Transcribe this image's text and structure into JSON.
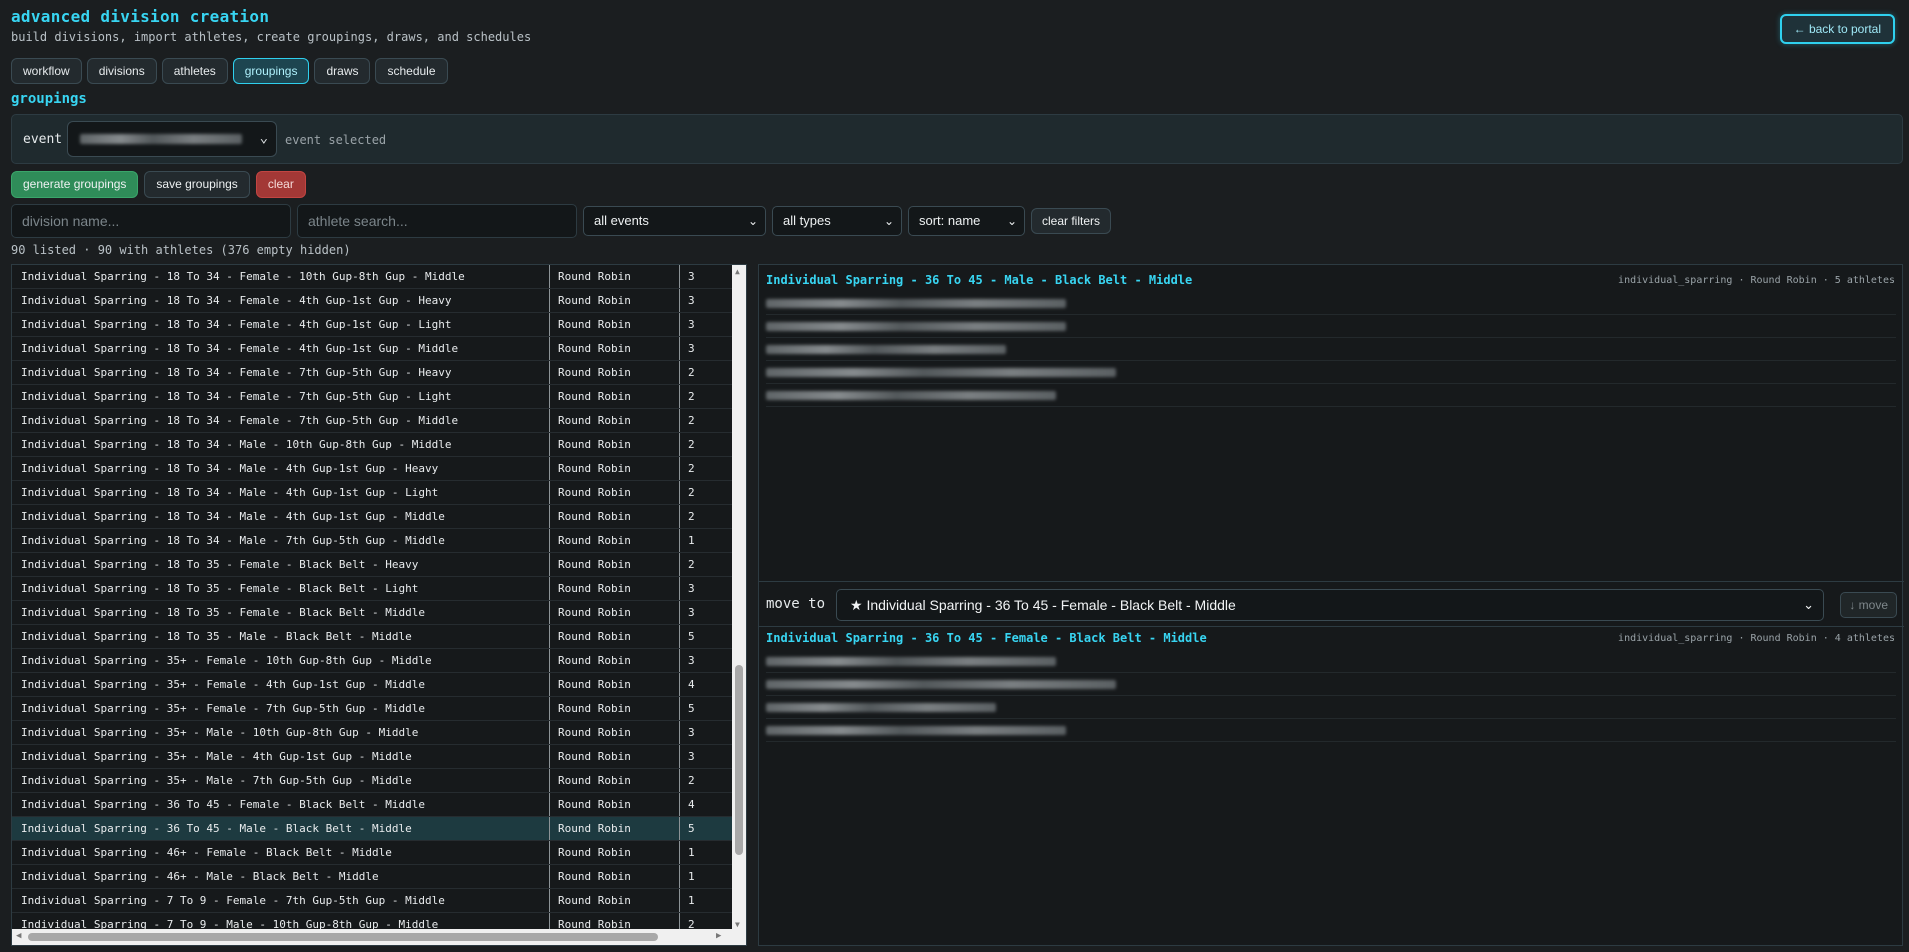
{
  "header": {
    "title": "advanced division creation",
    "subtitle": "build divisions, import athletes, create groupings, draws, and schedules",
    "back_label": "← back to portal"
  },
  "tabs": [
    {
      "label": "workflow",
      "active": false
    },
    {
      "label": "divisions",
      "active": false
    },
    {
      "label": "athletes",
      "active": false
    },
    {
      "label": "groupings",
      "active": true
    },
    {
      "label": "draws",
      "active": false
    },
    {
      "label": "schedule",
      "active": false
    }
  ],
  "section_title": "groupings",
  "event_bar": {
    "label": "event",
    "status": "event selected",
    "chevron_icon": "chevron-down-icon"
  },
  "actions": {
    "generate": "generate groupings",
    "save": "save groupings",
    "clear": "clear"
  },
  "filters": {
    "division_placeholder": "division name...",
    "athlete_placeholder": "athlete search...",
    "event_filter": "all events",
    "type_filter": "all types",
    "sort": "sort: name",
    "clear_label": "clear filters"
  },
  "summary": "90 listed · 90 with athletes (376 empty hidden)",
  "divisions": [
    {
      "name": "Individual Sparring - 18 To 34 - Female - 10th Gup-8th Gup - Middle",
      "type": "Round Robin",
      "count": "3"
    },
    {
      "name": "Individual Sparring - 18 To 34 - Female - 4th Gup-1st Gup - Heavy",
      "type": "Round Robin",
      "count": "3"
    },
    {
      "name": "Individual Sparring - 18 To 34 - Female - 4th Gup-1st Gup - Light",
      "type": "Round Robin",
      "count": "3"
    },
    {
      "name": "Individual Sparring - 18 To 34 - Female - 4th Gup-1st Gup - Middle",
      "type": "Round Robin",
      "count": "3"
    },
    {
      "name": "Individual Sparring - 18 To 34 - Female - 7th Gup-5th Gup - Heavy",
      "type": "Round Robin",
      "count": "2"
    },
    {
      "name": "Individual Sparring - 18 To 34 - Female - 7th Gup-5th Gup - Light",
      "type": "Round Robin",
      "count": "2"
    },
    {
      "name": "Individual Sparring - 18 To 34 - Female - 7th Gup-5th Gup - Middle",
      "type": "Round Robin",
      "count": "2"
    },
    {
      "name": "Individual Sparring - 18 To 34 - Male - 10th Gup-8th Gup - Middle",
      "type": "Round Robin",
      "count": "2"
    },
    {
      "name": "Individual Sparring - 18 To 34 - Male - 4th Gup-1st Gup - Heavy",
      "type": "Round Robin",
      "count": "2"
    },
    {
      "name": "Individual Sparring - 18 To 34 - Male - 4th Gup-1st Gup - Light",
      "type": "Round Robin",
      "count": "2"
    },
    {
      "name": "Individual Sparring - 18 To 34 - Male - 4th Gup-1st Gup - Middle",
      "type": "Round Robin",
      "count": "2"
    },
    {
      "name": "Individual Sparring - 18 To 34 - Male - 7th Gup-5th Gup - Middle",
      "type": "Round Robin",
      "count": "1"
    },
    {
      "name": "Individual Sparring - 18 To 35 - Female - Black Belt - Heavy",
      "type": "Round Robin",
      "count": "2"
    },
    {
      "name": "Individual Sparring - 18 To 35 - Female - Black Belt - Light",
      "type": "Round Robin",
      "count": "3"
    },
    {
      "name": "Individual Sparring - 18 To 35 - Female - Black Belt - Middle",
      "type": "Round Robin",
      "count": "3"
    },
    {
      "name": "Individual Sparring - 18 To 35 - Male - Black Belt - Middle",
      "type": "Round Robin",
      "count": "5"
    },
    {
      "name": "Individual Sparring - 35+ - Female - 10th Gup-8th Gup - Middle",
      "type": "Round Robin",
      "count": "3"
    },
    {
      "name": "Individual Sparring - 35+ - Female - 4th Gup-1st Gup - Middle",
      "type": "Round Robin",
      "count": "4"
    },
    {
      "name": "Individual Sparring - 35+ - Female - 7th Gup-5th Gup - Middle",
      "type": "Round Robin",
      "count": "5"
    },
    {
      "name": "Individual Sparring - 35+ - Male - 10th Gup-8th Gup - Middle",
      "type": "Round Robin",
      "count": "3"
    },
    {
      "name": "Individual Sparring - 35+ - Male - 4th Gup-1st Gup - Middle",
      "type": "Round Robin",
      "count": "3"
    },
    {
      "name": "Individual Sparring - 35+ - Male - 7th Gup-5th Gup - Middle",
      "type": "Round Robin",
      "count": "2"
    },
    {
      "name": "Individual Sparring - 36 To 45 - Female - Black Belt - Middle",
      "type": "Round Robin",
      "count": "4"
    },
    {
      "name": "Individual Sparring - 36 To 45 - Male - Black Belt - Middle",
      "type": "Round Robin",
      "count": "5",
      "selected": true
    },
    {
      "name": "Individual Sparring - 46+ - Female - Black Belt - Middle",
      "type": "Round Robin",
      "count": "1"
    },
    {
      "name": "Individual Sparring - 46+ - Male - Black Belt - Middle",
      "type": "Round Robin",
      "count": "1"
    },
    {
      "name": "Individual Sparring - 7 To 9 - Female - 7th Gup-5th Gup - Middle",
      "type": "Round Robin",
      "count": "1"
    },
    {
      "name": "Individual Sparring - 7 To 9 - Male - 10th Gup-8th Gup - Middle",
      "type": "Round Robin",
      "count": "2"
    }
  ],
  "detail": {
    "primary": {
      "title": "Individual Sparring - 36 To 45 - Male - Black Belt - Middle",
      "meta": "individual_sparring · Round Robin · 5 athletes",
      "athlete_count": 5
    },
    "move": {
      "label": "move to",
      "selected": "★ Individual Sparring - 36 To 45 - Female - Black Belt - Middle",
      "button": "↓ move"
    },
    "secondary": {
      "title": "Individual Sparring - 36 To 45 - Female - Black Belt - Middle",
      "meta": "individual_sparring · Round Robin · 4 athletes",
      "athlete_count": 4
    }
  },
  "colors": {
    "accent": "#38d5f2",
    "background": "#1b1e20",
    "green": "#2f8c59",
    "red": "#a33836",
    "selected_row": "#1d3a40"
  }
}
